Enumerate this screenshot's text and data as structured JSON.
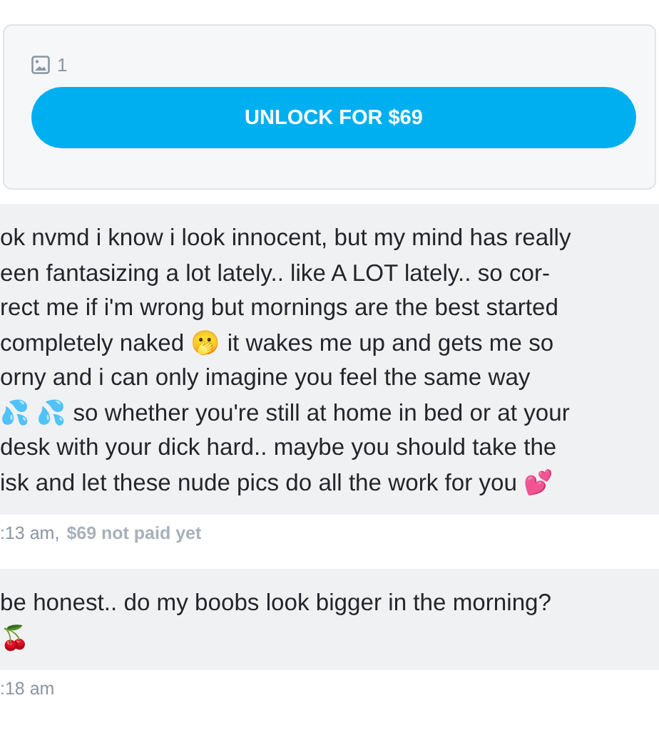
{
  "locked_media": {
    "photo_count": "1",
    "unlock_button": "UNLOCK FOR $69"
  },
  "messages": [
    {
      "lines": [
        "ok nvmd i know i look innocent, but my mind has really",
        "een fantasizing a lot lately.. like A LOT lately.. so cor-",
        "rect me if i'm wrong but mornings are the best started",
        "completely naked 🫢 it wakes me up and gets me so",
        "orny and i can only imagine you feel the same way",
        "💦 💦 so whether you're still at home in bed or at your",
        "desk with your dick hard.. maybe you should take the",
        "isk and let these nude pics do all the work for you 💕"
      ],
      "time": ":13 am,",
      "price_status": "$69 not paid yet"
    },
    {
      "lines": [
        "be honest.. do my boobs look bigger in the morning?",
        "🍒"
      ],
      "time": ":18 am"
    }
  ]
}
